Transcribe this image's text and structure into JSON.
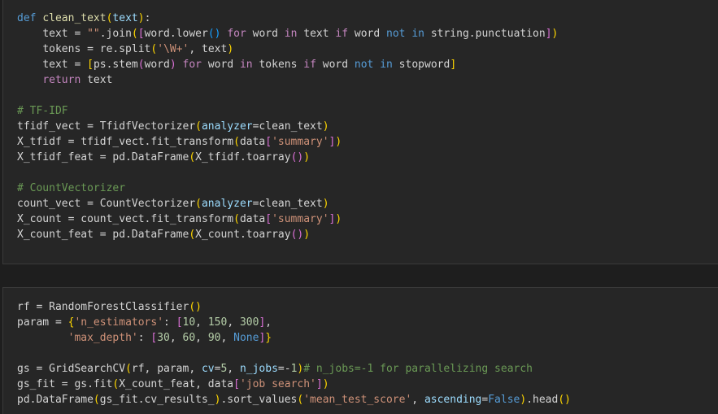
{
  "cells": [
    {
      "lines": [
        [
          {
            "t": "def",
            "c": "kw"
          },
          {
            "t": " "
          },
          {
            "t": "clean_text",
            "c": "fn"
          },
          {
            "t": "(",
            "c": "br1"
          },
          {
            "t": "text",
            "c": "param"
          },
          {
            "t": ")",
            "c": "br1"
          },
          {
            "t": ":"
          }
        ],
        [
          {
            "t": "    "
          },
          {
            "t": "text = "
          },
          {
            "t": "\"\"",
            "c": "str"
          },
          {
            "t": ".join"
          },
          {
            "t": "(",
            "c": "br1"
          },
          {
            "t": "[",
            "c": "br2"
          },
          {
            "t": "word.lower"
          },
          {
            "t": "()",
            "c": "br3"
          },
          {
            "t": " "
          },
          {
            "t": "for",
            "c": "ctl"
          },
          {
            "t": " word "
          },
          {
            "t": "in",
            "c": "ctl"
          },
          {
            "t": " text "
          },
          {
            "t": "if",
            "c": "ctl"
          },
          {
            "t": " word "
          },
          {
            "t": "not",
            "c": "kw"
          },
          {
            "t": " "
          },
          {
            "t": "in",
            "c": "kw"
          },
          {
            "t": " string.punctuation"
          },
          {
            "t": "]",
            "c": "br2"
          },
          {
            "t": ")",
            "c": "br1"
          }
        ],
        [
          {
            "t": "    "
          },
          {
            "t": "tokens = re.split"
          },
          {
            "t": "(",
            "c": "br1"
          },
          {
            "t": "'\\W+'",
            "c": "str"
          },
          {
            "t": ", text"
          },
          {
            "t": ")",
            "c": "br1"
          }
        ],
        [
          {
            "t": "    "
          },
          {
            "t": "text = "
          },
          {
            "t": "[",
            "c": "br1"
          },
          {
            "t": "ps.stem"
          },
          {
            "t": "(",
            "c": "br2"
          },
          {
            "t": "word"
          },
          {
            "t": ")",
            "c": "br2"
          },
          {
            "t": " "
          },
          {
            "t": "for",
            "c": "ctl"
          },
          {
            "t": " word "
          },
          {
            "t": "in",
            "c": "ctl"
          },
          {
            "t": " tokens "
          },
          {
            "t": "if",
            "c": "ctl"
          },
          {
            "t": " word "
          },
          {
            "t": "not",
            "c": "kw"
          },
          {
            "t": " "
          },
          {
            "t": "in",
            "c": "kw"
          },
          {
            "t": " stopword"
          },
          {
            "t": "]",
            "c": "br1"
          }
        ],
        [
          {
            "t": "    "
          },
          {
            "t": "return",
            "c": "ctl"
          },
          {
            "t": " text"
          }
        ],
        [],
        [
          {
            "t": "# TF-IDF",
            "c": "com"
          }
        ],
        [
          {
            "t": "tfidf_vect = TfidfVectorizer"
          },
          {
            "t": "(",
            "c": "br1"
          },
          {
            "t": "analyzer",
            "c": "param"
          },
          {
            "t": "=clean_text"
          },
          {
            "t": ")",
            "c": "br1"
          }
        ],
        [
          {
            "t": "X_tfidf = tfidf_vect.fit_transform"
          },
          {
            "t": "(",
            "c": "br1"
          },
          {
            "t": "data"
          },
          {
            "t": "[",
            "c": "br2"
          },
          {
            "t": "'summary'",
            "c": "str"
          },
          {
            "t": "]",
            "c": "br2"
          },
          {
            "t": ")",
            "c": "br1"
          }
        ],
        [
          {
            "t": "X_tfidf_feat = pd.DataFrame"
          },
          {
            "t": "(",
            "c": "br1"
          },
          {
            "t": "X_tfidf.toarray"
          },
          {
            "t": "()",
            "c": "br2"
          },
          {
            "t": ")",
            "c": "br1"
          }
        ],
        [],
        [
          {
            "t": "# CountVectorizer",
            "c": "com"
          }
        ],
        [
          {
            "t": "count_vect = CountVectorizer"
          },
          {
            "t": "(",
            "c": "br1"
          },
          {
            "t": "analyzer",
            "c": "param"
          },
          {
            "t": "=clean_text"
          },
          {
            "t": ")",
            "c": "br1"
          }
        ],
        [
          {
            "t": "X_count = count_vect.fit_transform"
          },
          {
            "t": "(",
            "c": "br1"
          },
          {
            "t": "data"
          },
          {
            "t": "[",
            "c": "br2"
          },
          {
            "t": "'summary'",
            "c": "str"
          },
          {
            "t": "]",
            "c": "br2"
          },
          {
            "t": ")",
            "c": "br1"
          }
        ],
        [
          {
            "t": "X_count_feat = pd.DataFrame"
          },
          {
            "t": "(",
            "c": "br1"
          },
          {
            "t": "X_count.toarray"
          },
          {
            "t": "()",
            "c": "br2"
          },
          {
            "t": ")",
            "c": "br1"
          }
        ]
      ]
    },
    {
      "lines": [
        [
          {
            "t": "rf = RandomForestClassifier"
          },
          {
            "t": "()",
            "c": "br1"
          }
        ],
        [
          {
            "t": "param = "
          },
          {
            "t": "{",
            "c": "br1"
          },
          {
            "t": "'n_estimators'",
            "c": "str"
          },
          {
            "t": ": "
          },
          {
            "t": "[",
            "c": "br2"
          },
          {
            "t": "10",
            "c": "num"
          },
          {
            "t": ", "
          },
          {
            "t": "150",
            "c": "num"
          },
          {
            "t": ", "
          },
          {
            "t": "300",
            "c": "num"
          },
          {
            "t": "]",
            "c": "br2"
          },
          {
            "t": ","
          }
        ],
        [
          {
            "t": "        "
          },
          {
            "t": "'max_depth'",
            "c": "str"
          },
          {
            "t": ": "
          },
          {
            "t": "[",
            "c": "br2"
          },
          {
            "t": "30",
            "c": "num"
          },
          {
            "t": ", "
          },
          {
            "t": "60",
            "c": "num"
          },
          {
            "t": ", "
          },
          {
            "t": "90",
            "c": "num"
          },
          {
            "t": ", "
          },
          {
            "t": "None",
            "c": "kw"
          },
          {
            "t": "]",
            "c": "br2"
          },
          {
            "t": "}",
            "c": "br1"
          }
        ],
        [],
        [
          {
            "t": "gs = GridSearchCV"
          },
          {
            "t": "(",
            "c": "br1"
          },
          {
            "t": "rf, param, "
          },
          {
            "t": "cv",
            "c": "param"
          },
          {
            "t": "="
          },
          {
            "t": "5",
            "c": "num"
          },
          {
            "t": ", "
          },
          {
            "t": "n_jobs",
            "c": "param"
          },
          {
            "t": "=-"
          },
          {
            "t": "1",
            "c": "num"
          },
          {
            "t": ")",
            "c": "br1"
          },
          {
            "t": "# n_jobs=-1 for parallelizing search",
            "c": "com"
          }
        ],
        [
          {
            "t": "gs_fit = gs.fit"
          },
          {
            "t": "(",
            "c": "br1"
          },
          {
            "t": "X_count_feat, data"
          },
          {
            "t": "[",
            "c": "br2"
          },
          {
            "t": "'job search'",
            "c": "str"
          },
          {
            "t": "]",
            "c": "br2"
          },
          {
            "t": ")",
            "c": "br1"
          }
        ],
        [
          {
            "t": "pd.DataFrame"
          },
          {
            "t": "(",
            "c": "br1"
          },
          {
            "t": "gs_fit.cv_results_"
          },
          {
            "t": ")",
            "c": "br1"
          },
          {
            "t": ".sort_values"
          },
          {
            "t": "(",
            "c": "br1"
          },
          {
            "t": "'mean_test_score'",
            "c": "str"
          },
          {
            "t": ", "
          },
          {
            "t": "ascending",
            "c": "param"
          },
          {
            "t": "="
          },
          {
            "t": "False",
            "c": "kw"
          },
          {
            "t": ")",
            "c": "br1"
          },
          {
            "t": ".head"
          },
          {
            "t": "()",
            "c": "br1"
          }
        ]
      ]
    }
  ]
}
